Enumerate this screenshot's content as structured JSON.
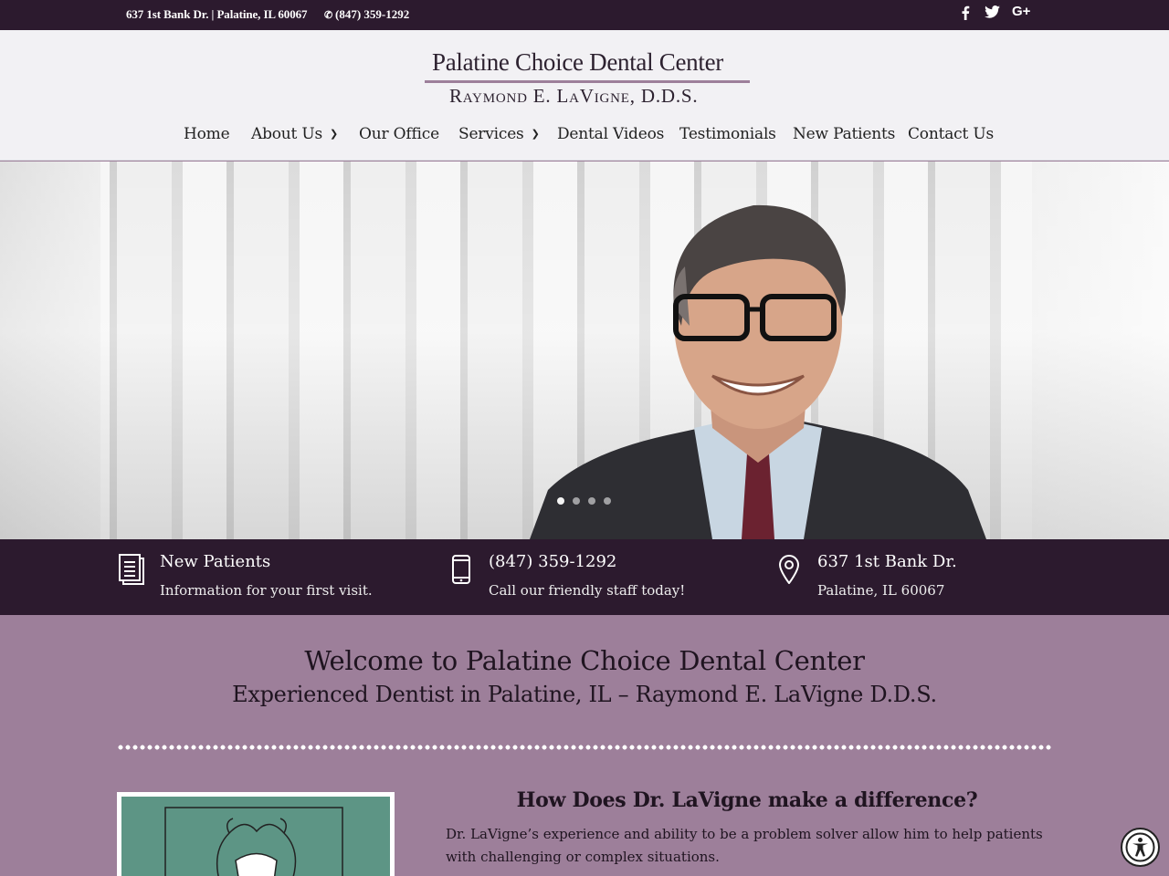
{
  "topbar": {
    "address": "637 1st Bank Dr. | Palatine, IL 60067",
    "phone": "(847) 359-1292",
    "social": [
      "facebook-icon",
      "twitter-icon",
      "google-plus-icon"
    ],
    "google_plus_text": "G+"
  },
  "logo": {
    "line1": "Palatine Choice Dental Center",
    "line2": "Raymond E. LaVigne, D.D.S."
  },
  "nav": {
    "items": [
      {
        "label": "Home",
        "has_dropdown": false
      },
      {
        "label": "About Us",
        "has_dropdown": true
      },
      {
        "label": "Our Office",
        "has_dropdown": false
      },
      {
        "label": "Services",
        "has_dropdown": true
      },
      {
        "label": "Dental Videos",
        "has_dropdown": false
      },
      {
        "label": "Testimonials",
        "has_dropdown": false
      },
      {
        "label": "New Patients",
        "has_dropdown": false
      },
      {
        "label": "Contact Us",
        "has_dropdown": false
      }
    ]
  },
  "hero": {
    "slide_count": 4,
    "active_slide": 1
  },
  "info": {
    "blocks": [
      {
        "icon": "document-icon",
        "title": "New Patients",
        "subtitle": "Information for your first visit."
      },
      {
        "icon": "mobile-phone-icon",
        "title": "(847) 359-1292",
        "subtitle": "Call our friendly staff today!"
      },
      {
        "icon": "map-pin-icon",
        "title": "637 1st Bank Dr.",
        "subtitle": "Palatine, IL 60067"
      }
    ]
  },
  "welcome": {
    "title": "Welcome to Palatine Choice Dental Center",
    "subtitle": "Experienced Dentist in Palatine, IL – Raymond E. LaVigne D.D.S."
  },
  "feature": {
    "heading": "How Does Dr. LaVigne make a difference?",
    "paragraph": "Dr. LaVigne’s experience and ability to be a problem solver allow him to help patients with challenging or complex situations."
  },
  "colors": {
    "topbar_bg": "#2c1a2e",
    "accent": "#9d7f9a",
    "header_bg": "#f2f1f4"
  }
}
